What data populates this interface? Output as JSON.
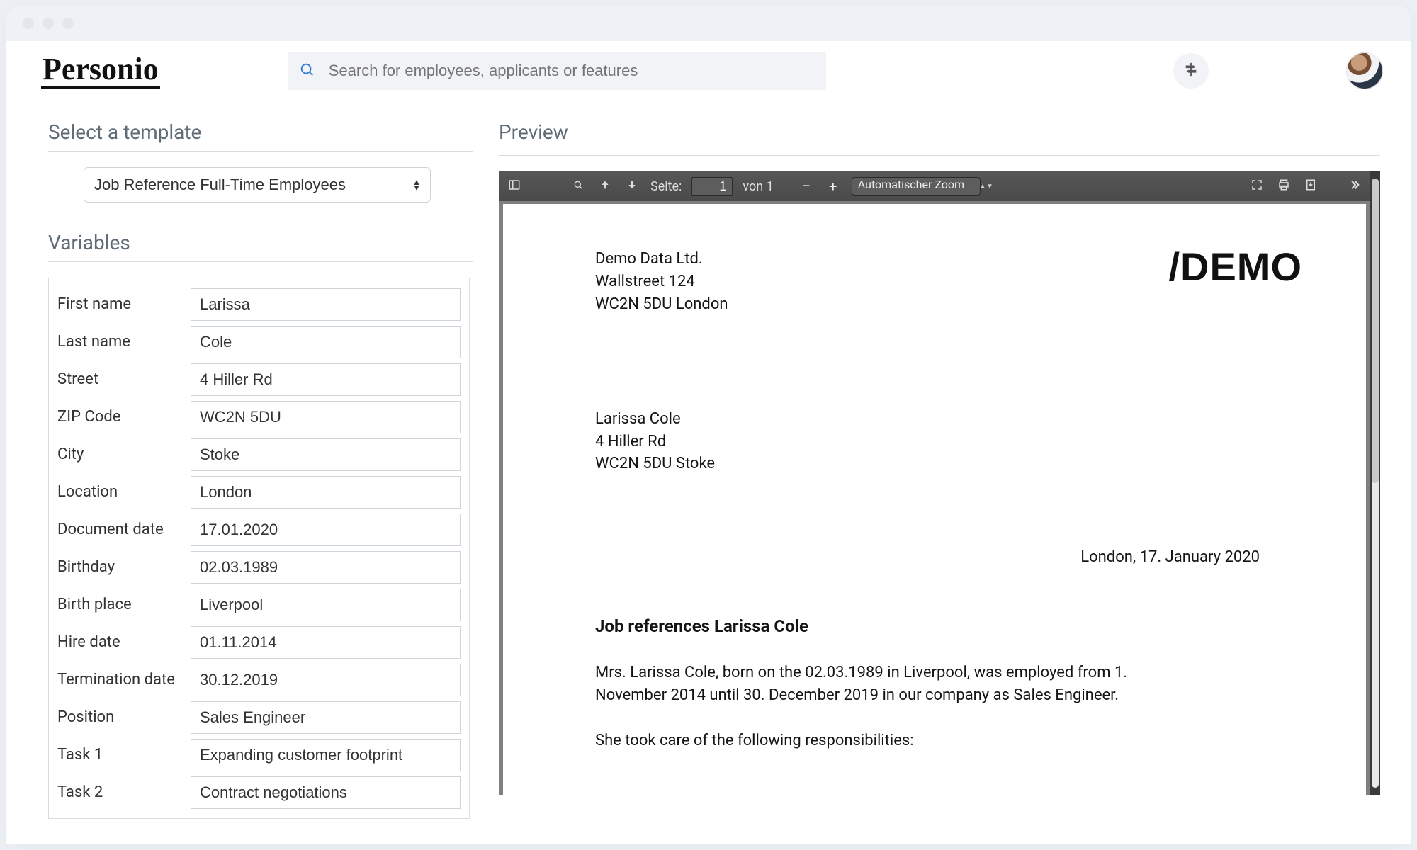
{
  "header": {
    "logo_text": "Personio",
    "search_placeholder": "Search for employees, applicants or features"
  },
  "left": {
    "select_title": "Select a template",
    "template_value": "Job Reference Full-Time Employees",
    "variables_title": "Variables",
    "fields": [
      {
        "label": "First name",
        "value": "Larissa"
      },
      {
        "label": "Last name",
        "value": "Cole"
      },
      {
        "label": "Street",
        "value": "4 Hiller Rd"
      },
      {
        "label": "ZIP Code",
        "value": "WC2N 5DU"
      },
      {
        "label": "City",
        "value": "Stoke"
      },
      {
        "label": "Location",
        "value": "London"
      },
      {
        "label": "Document date",
        "value": "17.01.2020"
      },
      {
        "label": "Birthday",
        "value": "02.03.1989"
      },
      {
        "label": "Birth place",
        "value": "Liverpool"
      },
      {
        "label": "Hire date",
        "value": "01.11.2014"
      },
      {
        "label": "Termination date",
        "value": "30.12.2019"
      },
      {
        "label": "Position",
        "value": "Sales Engineer"
      },
      {
        "label": "Task 1",
        "value": "Expanding customer footprint"
      },
      {
        "label": "Task 2",
        "value": "Contract negotiations"
      }
    ]
  },
  "preview": {
    "title": "Preview",
    "toolbar": {
      "page_label": "Seite:",
      "page_current": "1",
      "page_total_label": "von 1",
      "zoom_value": "Automatischer Zoom"
    },
    "document": {
      "watermark": "/DEMO",
      "company_line1": "Demo Data Ltd.",
      "company_line2": "Wallstreet 124",
      "company_line3": "WC2N 5DU London",
      "recipient_line1": "Larissa Cole",
      "recipient_line2": "4 Hiller Rd",
      "recipient_line3": "WC2N 5DU Stoke",
      "date_location": "London, 17. January 2020",
      "heading": "Job references Larissa Cole",
      "paragraph1": "Mrs. Larissa Cole, born on the 02.03.1989 in Liverpool, was employed from 1. November 2014 until 30. December 2019 in our company as Sales Engineer.",
      "paragraph2": "She took care of the following responsibilities:"
    }
  }
}
